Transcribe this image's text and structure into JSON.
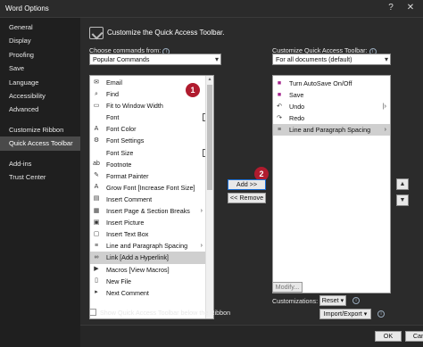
{
  "window": {
    "title": "Word Options",
    "help_glyph": "?",
    "close_glyph": "✕"
  },
  "sidebar": {
    "items": [
      {
        "label": "General"
      },
      {
        "label": "Display"
      },
      {
        "label": "Proofing"
      },
      {
        "label": "Save"
      },
      {
        "label": "Language"
      },
      {
        "label": "Accessibility"
      },
      {
        "label": "Advanced"
      },
      {
        "label": "Customize Ribbon"
      },
      {
        "label": "Quick Access Toolbar",
        "selected": true
      },
      {
        "label": "Add-ins"
      },
      {
        "label": "Trust Center"
      }
    ]
  },
  "header": {
    "title": "Customize the Quick Access Toolbar."
  },
  "left": {
    "label": "Choose commands from:",
    "dropdown_value": "Popular Commands",
    "items": [
      {
        "label": "Email",
        "icon": "✉"
      },
      {
        "label": "Find",
        "icon": "⌕"
      },
      {
        "label": "Fit to Window Width",
        "icon": "▭"
      },
      {
        "label": "Font",
        "icon": "",
        "box": "I"
      },
      {
        "label": "Font Color",
        "icon": "A"
      },
      {
        "label": "Font Settings",
        "icon": "⚙"
      },
      {
        "label": "Font Size",
        "icon": "",
        "box": "I"
      },
      {
        "label": "Footnote",
        "icon": "ab"
      },
      {
        "label": "Format Painter",
        "icon": "✎"
      },
      {
        "label": "Grow Font [Increase Font Size]",
        "icon": "A"
      },
      {
        "label": "Insert Comment",
        "icon": "▤"
      },
      {
        "label": "Insert Page & Section Breaks",
        "icon": "▦",
        "arrow": "›"
      },
      {
        "label": "Insert Picture",
        "icon": "▣"
      },
      {
        "label": "Insert Text Box",
        "icon": "▢"
      },
      {
        "label": "Line and Paragraph Spacing",
        "icon": "≡",
        "arrow": "›"
      },
      {
        "label": "Link [Add a Hyperlink]",
        "icon": "∞",
        "selected": true
      },
      {
        "label": "Macros [View Macros]",
        "icon": "▶"
      },
      {
        "label": "New File",
        "icon": "▯"
      },
      {
        "label": "Next Comment",
        "icon": "▸"
      }
    ]
  },
  "middle": {
    "add_label": "Add >>",
    "remove_label": "<< Remove"
  },
  "right": {
    "label": "Customize Quick Access Toolbar:",
    "dropdown_value": "For all documents (default)",
    "items": [
      {
        "label": "Turn AutoSave On/Off",
        "icon": "■"
      },
      {
        "label": "Save",
        "icon": "■"
      },
      {
        "label": "Undo",
        "icon": "↶",
        "arrow": "|›"
      },
      {
        "label": "Redo",
        "icon": "↷"
      },
      {
        "label": "Line and Paragraph Spacing",
        "icon": "≡",
        "arrow": "›",
        "selected": true
      }
    ],
    "modify_label": "Modify...",
    "customizations_label": "Customizations:",
    "reset_label": "Reset ▾",
    "import_export_label": "Import/Export ▾"
  },
  "checkbox": {
    "label": "Show Quick Access Toolbar below the Ribbon",
    "checked": false
  },
  "badges": {
    "one": "1",
    "two": "2"
  },
  "buttons": {
    "ok": "OK",
    "cancel": "Cancel"
  },
  "colors": {
    "badge": "#b01b2e",
    "selection": "#cfcfcf",
    "add_border": "#1a6fd6"
  }
}
